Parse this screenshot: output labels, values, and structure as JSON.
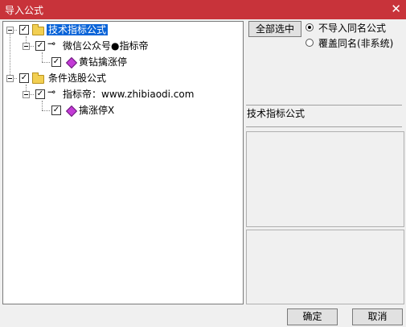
{
  "window": {
    "title": "导入公式",
    "close": "✕"
  },
  "tree": {
    "nodes": [
      {
        "label": "技术指标公式",
        "checked": "✓"
      },
      {
        "label": "微信公众号●指标帝",
        "checked": "✓"
      },
      {
        "label": "黄钻擒涨停",
        "checked": "✓"
      },
      {
        "label": "条件选股公式",
        "checked": "✓"
      },
      {
        "label": "指标帝：www.zhibiaodi.com",
        "checked": "✓"
      },
      {
        "label": "擒涨停X",
        "checked": "✓"
      }
    ]
  },
  "options": {
    "select_all": "全部选中",
    "radio_skip": "不导入同名公式",
    "radio_overwrite": "覆盖同名(非系统)"
  },
  "detail": {
    "label": "技术指标公式"
  },
  "footer": {
    "ok": "确定",
    "cancel": "取消"
  }
}
